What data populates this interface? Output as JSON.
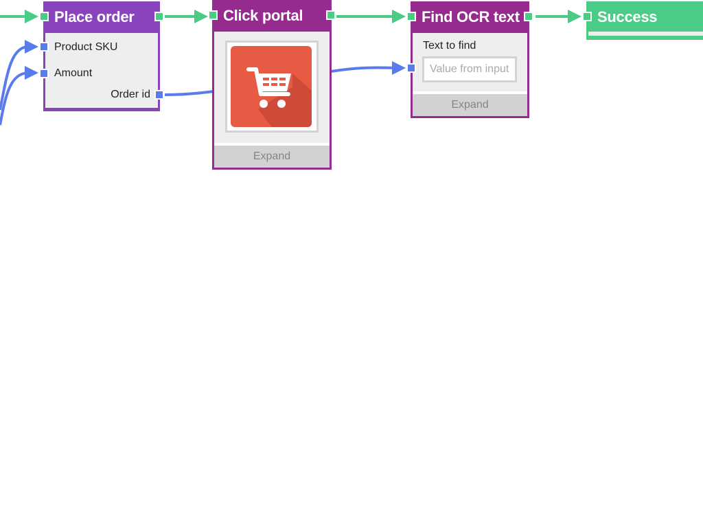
{
  "colors": {
    "flow": "#4bcc86",
    "data": "#597bec",
    "place_order": "#8843bd",
    "click_portal": "#952b8f",
    "find_ocr": "#952b8f",
    "success": "#4bcc86"
  },
  "nodes": {
    "place_order": {
      "title": "Place order",
      "inputs": [
        "Product SKU",
        "Amount"
      ],
      "outputs": [
        "Order id"
      ]
    },
    "click_portal": {
      "title": "Click portal",
      "image_icon": "shopping-cart-icon",
      "expand_label": "Expand"
    },
    "find_ocr": {
      "title": "Find OCR text",
      "field_label": "Text to find",
      "field_placeholder": "Value from input",
      "expand_label": "Expand"
    },
    "success": {
      "title": "Success"
    }
  }
}
